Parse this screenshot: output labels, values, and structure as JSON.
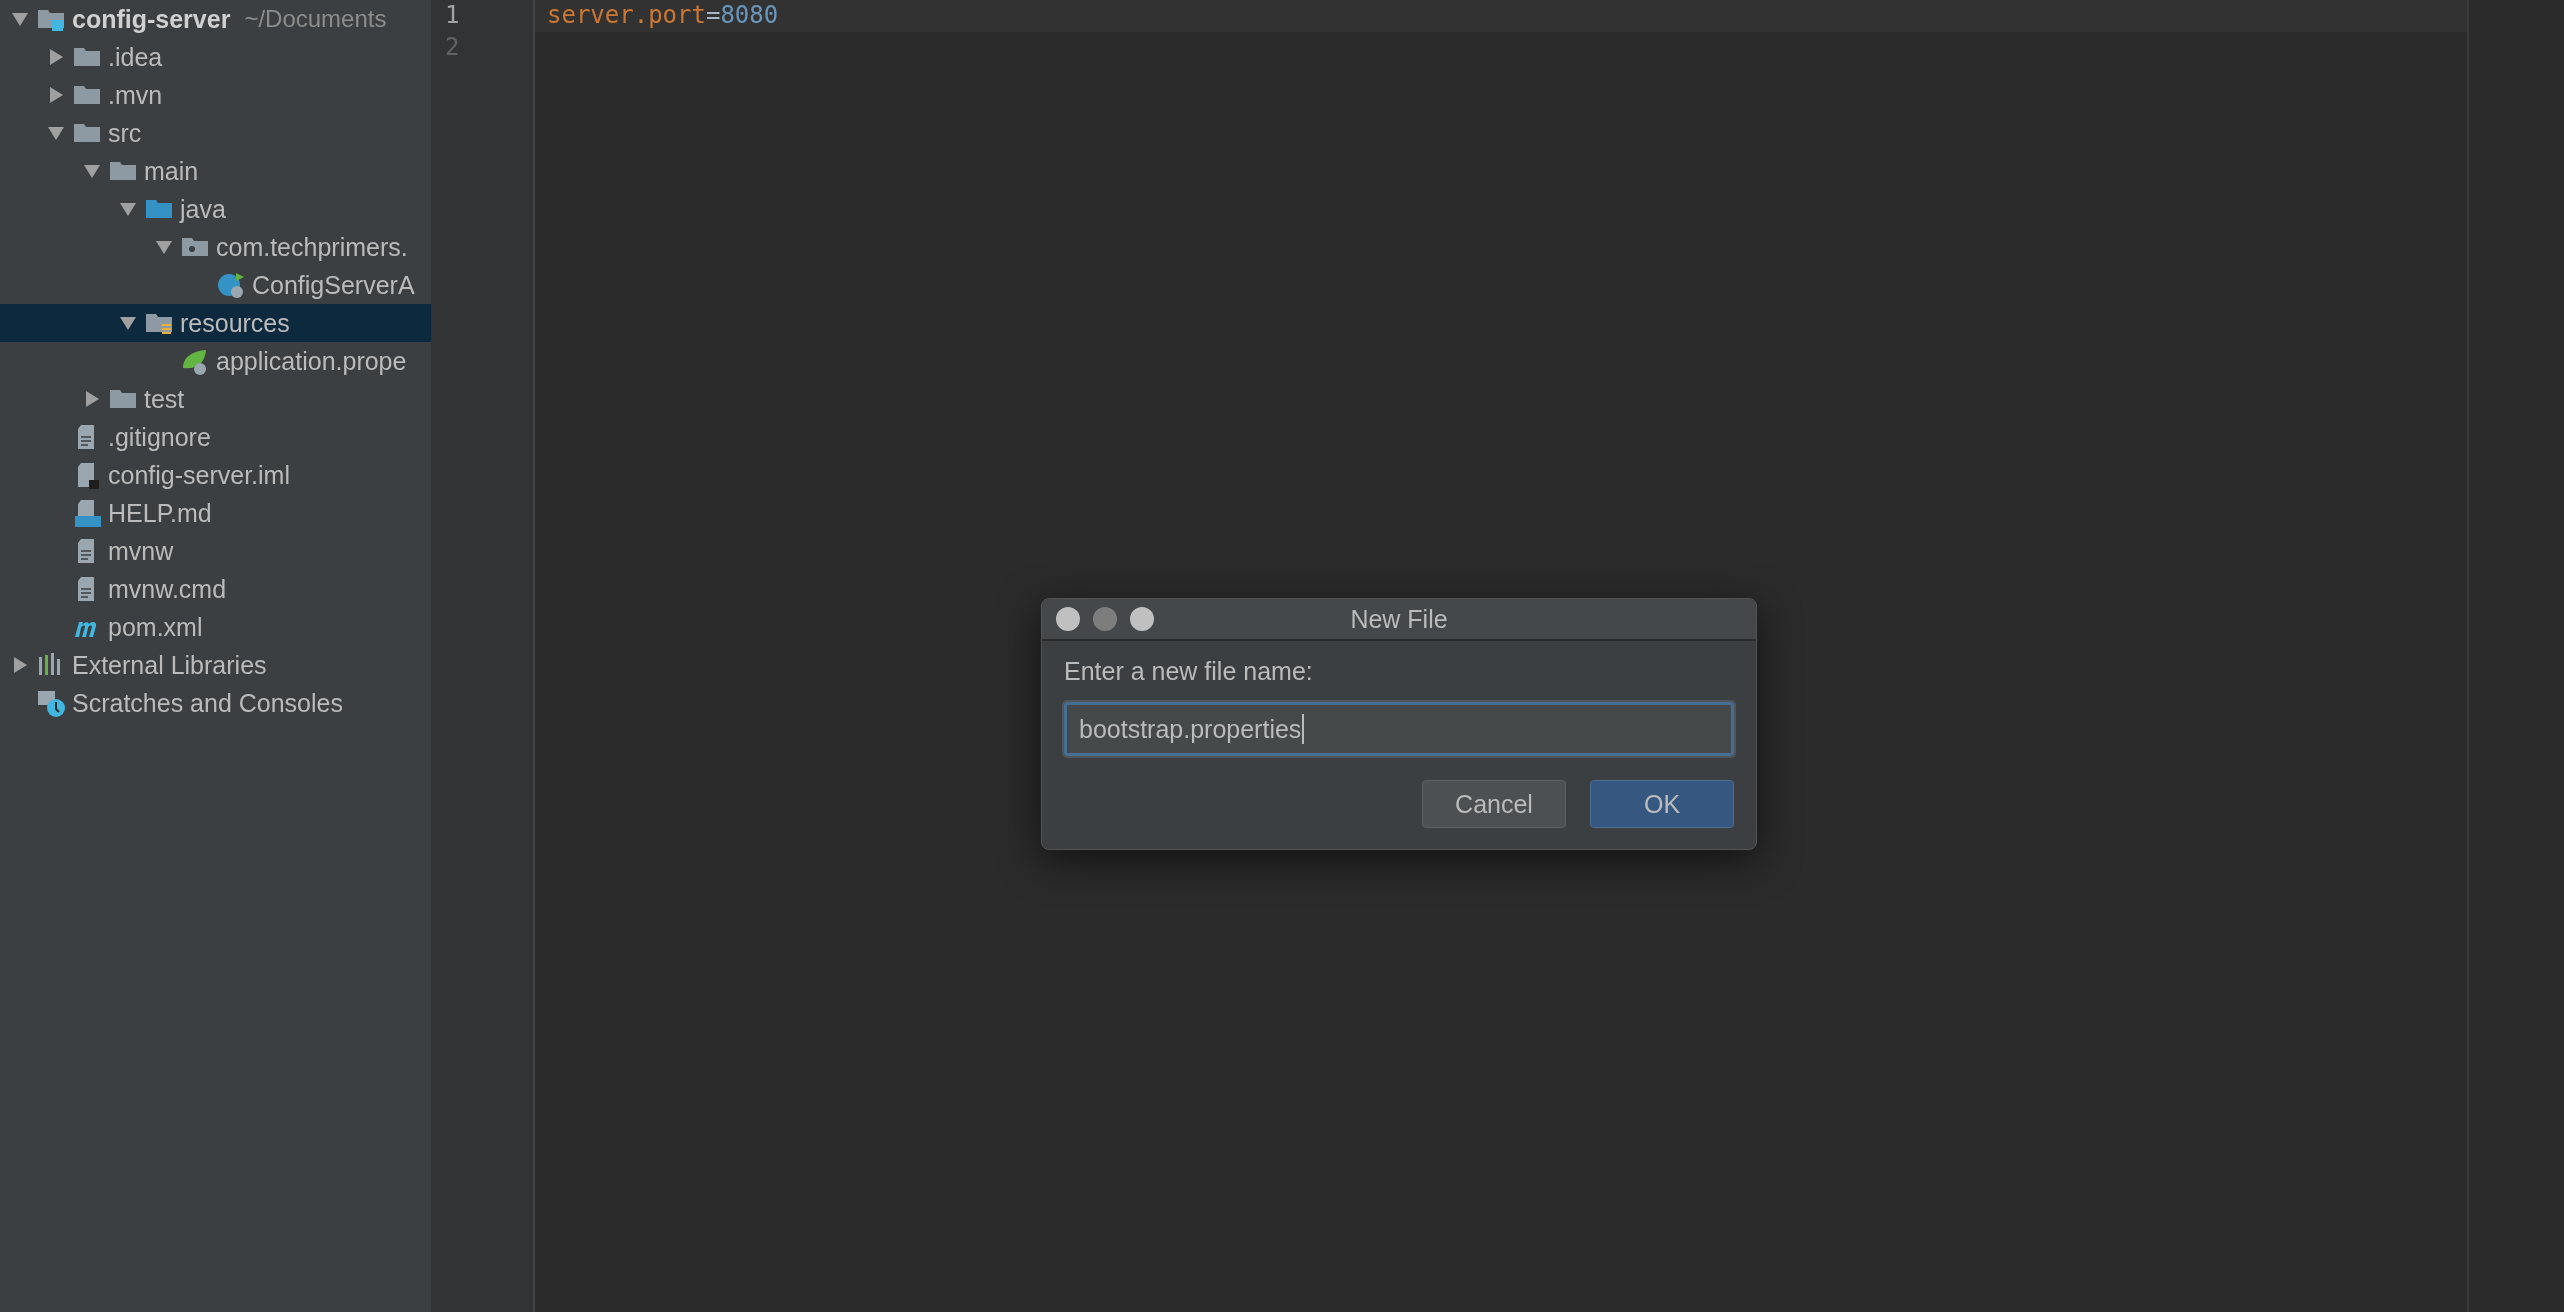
{
  "project_tree": [
    {
      "label": "config-server",
      "detail": "~/Documents",
      "kind": "project",
      "expanded": true,
      "selected": false,
      "children": [
        {
          "label": ".idea",
          "kind": "folder",
          "expanded": false,
          "selected": false
        },
        {
          "label": ".mvn",
          "kind": "folder",
          "expanded": false,
          "selected": false
        },
        {
          "label": "src",
          "kind": "folder",
          "expanded": true,
          "selected": false,
          "children": [
            {
              "label": "main",
              "kind": "folder",
              "expanded": true,
              "selected": false,
              "children": [
                {
                  "label": "java",
                  "kind": "source",
                  "expanded": true,
                  "selected": false,
                  "children": [
                    {
                      "label": "com.techprimers.",
                      "kind": "package",
                      "expanded": true,
                      "selected": false,
                      "children": [
                        {
                          "label": "ConfigServerA",
                          "kind": "class",
                          "selected": false
                        }
                      ]
                    }
                  ]
                },
                {
                  "label": "resources",
                  "kind": "resources",
                  "expanded": true,
                  "selected": true,
                  "children": [
                    {
                      "label": "application.prope",
                      "kind": "properties",
                      "selected": false
                    }
                  ]
                }
              ]
            },
            {
              "label": "test",
              "kind": "folder",
              "expanded": false,
              "selected": false
            }
          ]
        },
        {
          "label": ".gitignore",
          "kind": "text",
          "selected": false
        },
        {
          "label": "config-server.iml",
          "kind": "module",
          "selected": false
        },
        {
          "label": "HELP.md",
          "kind": "markdown",
          "selected": false
        },
        {
          "label": "mvnw",
          "kind": "text",
          "selected": false
        },
        {
          "label": "mvnw.cmd",
          "kind": "text",
          "selected": false
        },
        {
          "label": "pom.xml",
          "kind": "maven",
          "selected": false
        }
      ]
    },
    {
      "label": "External Libraries",
      "kind": "libraries",
      "expanded": false,
      "selected": false
    },
    {
      "label": "Scratches and Consoles",
      "kind": "scratches",
      "selected": false
    }
  ],
  "editor": {
    "lines": [
      {
        "number": "1",
        "current": true,
        "tokens": [
          {
            "text": "server.port",
            "kind": "key"
          },
          {
            "text": "=",
            "kind": "operator"
          },
          {
            "text": "8080",
            "kind": "number"
          }
        ]
      },
      {
        "number": "2",
        "current": false
      }
    ]
  },
  "dialog": {
    "title": "New File",
    "prompt": "Enter a new file name:",
    "value": "bootstrap.properties",
    "buttons": [
      {
        "label": "Cancel",
        "default": false
      },
      {
        "label": "OK",
        "default": true
      }
    ]
  }
}
